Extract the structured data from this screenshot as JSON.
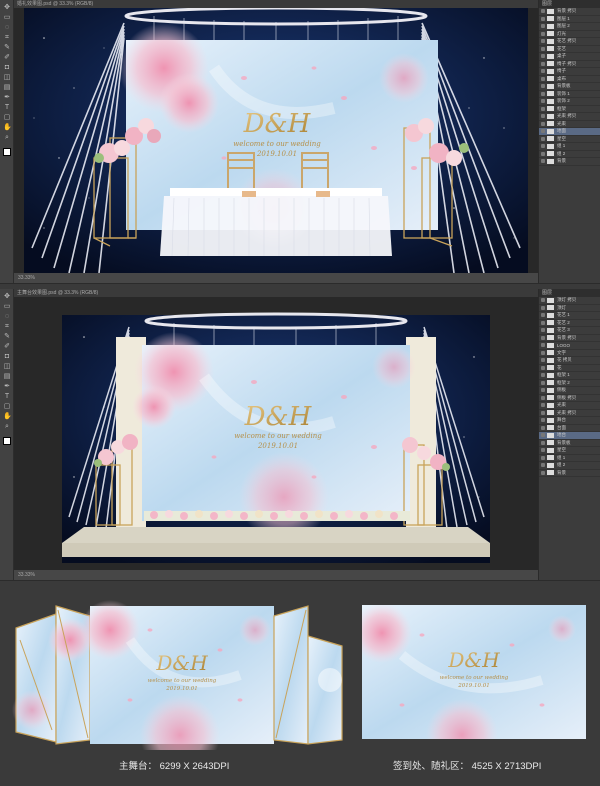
{
  "window1": {
    "tab_label": "婚礼效果图.psd @ 33.3% (RGB/8)",
    "status": "33.33%",
    "backdrop_monogram": "D&H",
    "backdrop_welcome": "welcome to our wedding",
    "backdrop_date": "2019.10.01",
    "panel_title": "图层",
    "layers": [
      "背景 拷贝",
      "图层 1",
      "图层 2",
      "灯光",
      "花艺 拷贝",
      "花艺",
      "桌子",
      "椅子 拷贝",
      "椅子",
      "桌布",
      "背景板",
      "装饰 1",
      "装饰 2",
      "框架",
      "光束 拷贝",
      "光束",
      "地面",
      "星空",
      "组 1",
      "组 2",
      "背景"
    ]
  },
  "window2": {
    "tab_label": "主舞台效果图.psd @ 33.3% (RGB/8)",
    "status": "33.33%",
    "backdrop_monogram": "D&H",
    "backdrop_welcome": "welcome to our wedding",
    "backdrop_date": "2019.10.01",
    "panel_title": "图层",
    "layers": [
      "顶灯 拷贝",
      "顶灯",
      "花艺 1",
      "花艺 2",
      "花艺 3",
      "背景 拷贝",
      "LOGO",
      "文字",
      "花 拷贝",
      "花",
      "框架 1",
      "框架 2",
      "侧板",
      "侧板 拷贝",
      "光束",
      "光束 拷贝",
      "舞台",
      "台面",
      "地台",
      "背景板",
      "星空",
      "组 1",
      "组 2",
      "背景"
    ]
  },
  "preview_main": {
    "monogram": "D&H",
    "welcome": "welcome to our wedding",
    "date": "2019.10.01",
    "caption": "主舞台：  6299 X 2643DPI"
  },
  "preview_sign": {
    "monogram": "D&H",
    "welcome": "welcome to our wedding",
    "date": "2019.10.01",
    "caption": "签到处、随礼区：  4525 X 2713DPI"
  },
  "colors": {
    "accent_gold": "#c9a35a",
    "sky_blue": "#cfe4f3",
    "blossom_pink": "#f3b6c8",
    "night_sky": "#0b1a3a"
  }
}
